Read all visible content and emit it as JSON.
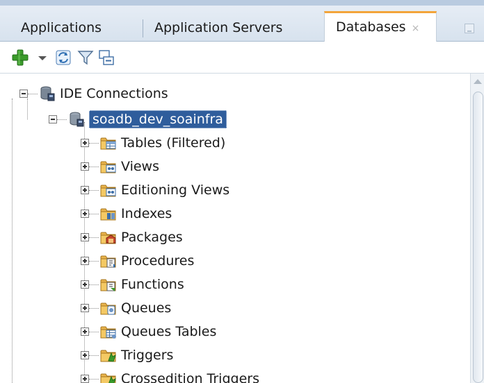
{
  "tabs": [
    {
      "label": "Applications"
    },
    {
      "label": "Application Servers"
    },
    {
      "label": "Databases",
      "close": "×"
    }
  ],
  "toolbar": {
    "icons": [
      "add-icon",
      "dropdown-arrow-icon",
      "refresh-icon",
      "filter-icon",
      "collapse-all-icon"
    ]
  },
  "tree": {
    "root": {
      "label": "IDE Connections",
      "icon": "database-connections-icon"
    },
    "connection": {
      "label": "soadb_dev_soainfra",
      "icon": "database-icon",
      "selected": true
    },
    "children": [
      {
        "label": "Tables (Filtered)",
        "icon": "tables-folder-icon"
      },
      {
        "label": "Views",
        "icon": "views-folder-icon"
      },
      {
        "label": "Editioning Views",
        "icon": "editioning-views-folder-icon"
      },
      {
        "label": "Indexes",
        "icon": "indexes-folder-icon"
      },
      {
        "label": "Packages",
        "icon": "packages-folder-icon"
      },
      {
        "label": "Procedures",
        "icon": "procedures-folder-icon"
      },
      {
        "label": "Functions",
        "icon": "functions-folder-icon"
      },
      {
        "label": "Queues",
        "icon": "queues-folder-icon"
      },
      {
        "label": "Queues Tables",
        "icon": "queues-tables-folder-icon"
      },
      {
        "label": "Triggers",
        "icon": "triggers-folder-icon"
      },
      {
        "label": "Crossedition Triggers",
        "icon": "crossedition-triggers-folder-icon"
      }
    ]
  },
  "colors": {
    "selection": "#2f5d9c",
    "active_tab_accent": "#f3a43a",
    "tabbar": "#dbe5f0",
    "add_icon": "#3a9a2a"
  }
}
